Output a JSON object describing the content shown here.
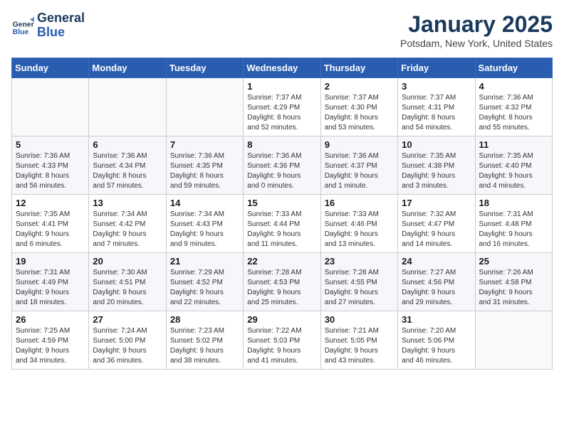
{
  "header": {
    "logo_line1": "General",
    "logo_line2": "Blue",
    "month": "January 2025",
    "location": "Potsdam, New York, United States"
  },
  "weekdays": [
    "Sunday",
    "Monday",
    "Tuesday",
    "Wednesday",
    "Thursday",
    "Friday",
    "Saturday"
  ],
  "weeks": [
    [
      {
        "day": "",
        "info": ""
      },
      {
        "day": "",
        "info": ""
      },
      {
        "day": "",
        "info": ""
      },
      {
        "day": "1",
        "info": "Sunrise: 7:37 AM\nSunset: 4:29 PM\nDaylight: 8 hours\nand 52 minutes."
      },
      {
        "day": "2",
        "info": "Sunrise: 7:37 AM\nSunset: 4:30 PM\nDaylight: 8 hours\nand 53 minutes."
      },
      {
        "day": "3",
        "info": "Sunrise: 7:37 AM\nSunset: 4:31 PM\nDaylight: 8 hours\nand 54 minutes."
      },
      {
        "day": "4",
        "info": "Sunrise: 7:36 AM\nSunset: 4:32 PM\nDaylight: 8 hours\nand 55 minutes."
      }
    ],
    [
      {
        "day": "5",
        "info": "Sunrise: 7:36 AM\nSunset: 4:33 PM\nDaylight: 8 hours\nand 56 minutes."
      },
      {
        "day": "6",
        "info": "Sunrise: 7:36 AM\nSunset: 4:34 PM\nDaylight: 8 hours\nand 57 minutes."
      },
      {
        "day": "7",
        "info": "Sunrise: 7:36 AM\nSunset: 4:35 PM\nDaylight: 8 hours\nand 59 minutes."
      },
      {
        "day": "8",
        "info": "Sunrise: 7:36 AM\nSunset: 4:36 PM\nDaylight: 9 hours\nand 0 minutes."
      },
      {
        "day": "9",
        "info": "Sunrise: 7:36 AM\nSunset: 4:37 PM\nDaylight: 9 hours\nand 1 minute."
      },
      {
        "day": "10",
        "info": "Sunrise: 7:35 AM\nSunset: 4:38 PM\nDaylight: 9 hours\nand 3 minutes."
      },
      {
        "day": "11",
        "info": "Sunrise: 7:35 AM\nSunset: 4:40 PM\nDaylight: 9 hours\nand 4 minutes."
      }
    ],
    [
      {
        "day": "12",
        "info": "Sunrise: 7:35 AM\nSunset: 4:41 PM\nDaylight: 9 hours\nand 6 minutes."
      },
      {
        "day": "13",
        "info": "Sunrise: 7:34 AM\nSunset: 4:42 PM\nDaylight: 9 hours\nand 7 minutes."
      },
      {
        "day": "14",
        "info": "Sunrise: 7:34 AM\nSunset: 4:43 PM\nDaylight: 9 hours\nand 9 minutes."
      },
      {
        "day": "15",
        "info": "Sunrise: 7:33 AM\nSunset: 4:44 PM\nDaylight: 9 hours\nand 11 minutes."
      },
      {
        "day": "16",
        "info": "Sunrise: 7:33 AM\nSunset: 4:46 PM\nDaylight: 9 hours\nand 13 minutes."
      },
      {
        "day": "17",
        "info": "Sunrise: 7:32 AM\nSunset: 4:47 PM\nDaylight: 9 hours\nand 14 minutes."
      },
      {
        "day": "18",
        "info": "Sunrise: 7:31 AM\nSunset: 4:48 PM\nDaylight: 9 hours\nand 16 minutes."
      }
    ],
    [
      {
        "day": "19",
        "info": "Sunrise: 7:31 AM\nSunset: 4:49 PM\nDaylight: 9 hours\nand 18 minutes."
      },
      {
        "day": "20",
        "info": "Sunrise: 7:30 AM\nSunset: 4:51 PM\nDaylight: 9 hours\nand 20 minutes."
      },
      {
        "day": "21",
        "info": "Sunrise: 7:29 AM\nSunset: 4:52 PM\nDaylight: 9 hours\nand 22 minutes."
      },
      {
        "day": "22",
        "info": "Sunrise: 7:28 AM\nSunset: 4:53 PM\nDaylight: 9 hours\nand 25 minutes."
      },
      {
        "day": "23",
        "info": "Sunrise: 7:28 AM\nSunset: 4:55 PM\nDaylight: 9 hours\nand 27 minutes."
      },
      {
        "day": "24",
        "info": "Sunrise: 7:27 AM\nSunset: 4:56 PM\nDaylight: 9 hours\nand 29 minutes."
      },
      {
        "day": "25",
        "info": "Sunrise: 7:26 AM\nSunset: 4:58 PM\nDaylight: 9 hours\nand 31 minutes."
      }
    ],
    [
      {
        "day": "26",
        "info": "Sunrise: 7:25 AM\nSunset: 4:59 PM\nDaylight: 9 hours\nand 34 minutes."
      },
      {
        "day": "27",
        "info": "Sunrise: 7:24 AM\nSunset: 5:00 PM\nDaylight: 9 hours\nand 36 minutes."
      },
      {
        "day": "28",
        "info": "Sunrise: 7:23 AM\nSunset: 5:02 PM\nDaylight: 9 hours\nand 38 minutes."
      },
      {
        "day": "29",
        "info": "Sunrise: 7:22 AM\nSunset: 5:03 PM\nDaylight: 9 hours\nand 41 minutes."
      },
      {
        "day": "30",
        "info": "Sunrise: 7:21 AM\nSunset: 5:05 PM\nDaylight: 9 hours\nand 43 minutes."
      },
      {
        "day": "31",
        "info": "Sunrise: 7:20 AM\nSunset: 5:06 PM\nDaylight: 9 hours\nand 46 minutes."
      },
      {
        "day": "",
        "info": ""
      }
    ]
  ]
}
